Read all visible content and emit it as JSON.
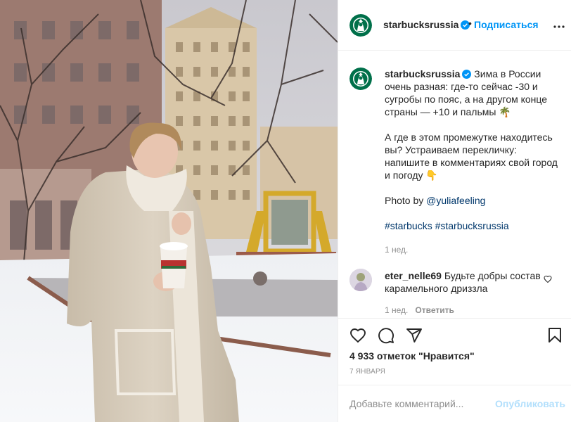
{
  "post": {
    "username": "starbucksrussia",
    "follow_label": "Подписаться",
    "dot": "•",
    "caption_p1": "Зима в России очень разная: где-то сейчас -30 и сугробы по пояс, а на другом конце страны — +10 и пальмы 🌴",
    "caption_p2": "А где в этом промежутке находитесь вы? Устраиваем перекличку: напишите в комментариях свой город и погоду 👇",
    "photo_by_label": "Photo by",
    "photo_by_handle": "@yuliafeeling",
    "hashtag1": "#starbucks",
    "hashtag2": "#starbucksrussia",
    "caption_time": "1 нед."
  },
  "comment": {
    "username": "eter_nelle69",
    "text": "Будьте добры состав карамельного дриззла",
    "time": "1 нед.",
    "reply_label": "Ответить"
  },
  "footer": {
    "likes": "4 933 отметок \"Нравится\"",
    "date": "7 ЯНВАРЯ",
    "comment_placeholder": "Добавьте комментарий...",
    "post_button": "Опубликовать"
  },
  "colors": {
    "accent": "#0095f6",
    "brand_green": "#00704a",
    "muted": "#8e8e8e"
  }
}
